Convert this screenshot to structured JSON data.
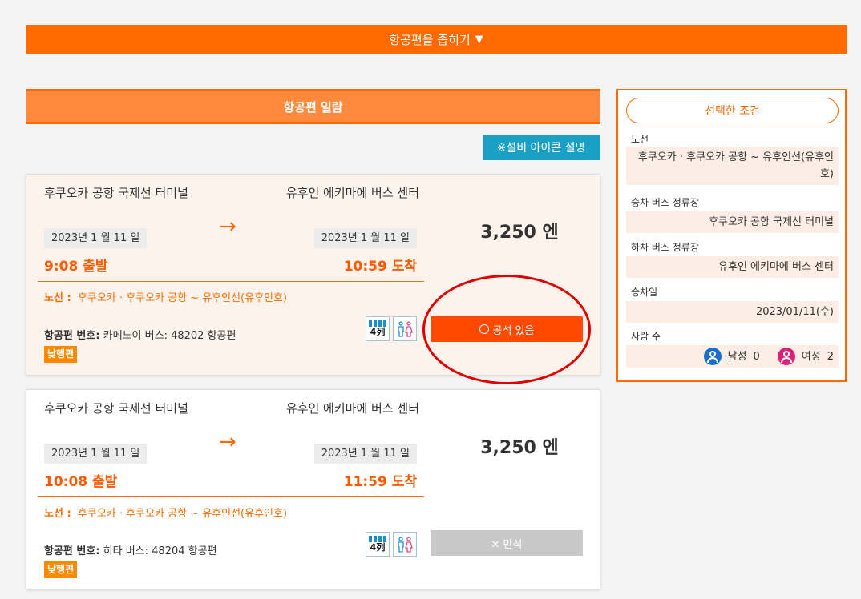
{
  "collapse": {
    "label": "항공편을 좁히기",
    "arrow": "▼"
  },
  "list_header": "항공편 일람",
  "icon_explain": "※설비 아이콘 설명",
  "cards": [
    {
      "from_name": "후쿠오카 공항 국제선 터미널",
      "to_name": "유후인 에키마에 버스 센터",
      "from_date": "2023년 1 월 11 일",
      "to_date": "2023년 1 월 11 일",
      "arrow": "→",
      "departure": "9:08 출발",
      "arrival": "10:59 도착",
      "price": "3,250 엔",
      "route_label": "노선 :",
      "route_value": "후쿠오카 · 후쿠오카 공항 ~ 유후인선(유후인호)",
      "flight_label": "항공편 번호:",
      "flight_value": "카메노이 버스: 48202 항공편",
      "badge": "낮행편",
      "seats_icon_label": "4列",
      "button": "공석 있음",
      "button_state": "available"
    },
    {
      "from_name": "후쿠오카 공항 국제선 터미널",
      "to_name": "유후인 에키마에 버스 센터",
      "from_date": "2023년 1 월 11 일",
      "to_date": "2023년 1 월 11 일",
      "arrow": "→",
      "departure": "10:08 출발",
      "arrival": "11:59 도착",
      "price": "3,250 엔",
      "route_label": "노선 :",
      "route_value": "후쿠오카 · 후쿠오카 공항 ~ 유후인선(유후인호)",
      "flight_label": "항공편 번호:",
      "flight_value": "히타 버스: 48204 항공편",
      "badge": "낮행편",
      "seats_icon_label": "4列",
      "button": "✕ 만석",
      "button_state": "full"
    }
  ],
  "conditions": {
    "title": "선택한 조건",
    "route_label": "노선",
    "route_value": "후쿠오카 · 후쿠오카 공항 ~ 유후인선(유후인호)",
    "board_label": "승차 버스 정류장",
    "board_value": "후쿠오카 공항 국제선 터미널",
    "alight_label": "하차 버스 정류장",
    "alight_value": "유후인 에키마에 버스 센터",
    "date_label": "승차일",
    "date_value": "2023/01/11(수)",
    "people_label": "사람 수",
    "male_label": "남성",
    "male_count": "0",
    "female_label": "여성",
    "female_count": "2"
  },
  "colors": {
    "accent": "#ff6a00",
    "button": "#ff4800",
    "info": "#1aa0c4",
    "full": "#c8c8c8"
  }
}
